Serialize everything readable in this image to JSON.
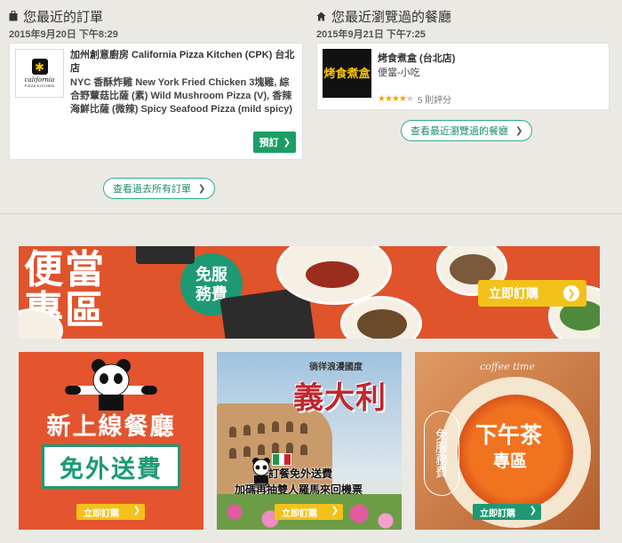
{
  "recent_orders": {
    "title": "您最近的訂單",
    "date": "2015年9月20日 下午8:29",
    "restaurant": "加州創意廚房 California Pizza Kitchen (CPK) 台北店",
    "items": "NYC 香酥炸雞 New York Fried Chicken 3塊雞, 綜合野蕈菇比薩 (素) Wild Mushroom Pizza (V), 香辣海鮮比薩 (微辣) Spicy Seafood Pizza (mild spicy)",
    "logo_text": "california",
    "logo_sub": "PIZZA KITCHEN",
    "reorder_label": "預訂",
    "view_all_label": "查看過去所有訂單"
  },
  "recent_viewed": {
    "title": "您最近瀏覽過的餐廳",
    "date": "2015年9月21日 下午7:25",
    "restaurant": "烤食煮盒 (台北店)",
    "category": "便當-小吃",
    "logo_text": "烤食煮盒",
    "rating_stars": 4,
    "rating_max": 5,
    "reviews": "5 則評分",
    "view_all_label": "查看最近瀏覽過的餐廳"
  },
  "banner": {
    "title_line1": "便當",
    "title_line2": "專區",
    "badge_line1": "免服",
    "badge_line2": "務費",
    "cta": "立即訂購"
  },
  "tiles": [
    {
      "title": "新上線餐廳",
      "box": "免外送費",
      "cta": "立即訂購"
    },
    {
      "tag": "徜徉浪漫國度",
      "title": "義大利",
      "line1": "訂餐免外送費",
      "line2": "加碼再抽雙人羅馬來回機票",
      "cta": "立即訂購"
    },
    {
      "tag": "coffee time",
      "title": "下午茶",
      "sub": "專區",
      "stamp": "免服務費",
      "cta": "立即訂購"
    }
  ],
  "colors": {
    "accent_green": "#1b9e66",
    "banner_orange": "#e0532b",
    "cta_yellow": "#f2c21b",
    "page_bg": "#ebe9e4"
  },
  "icons": {
    "orders": "shopping-bag-icon",
    "viewed": "home-icon",
    "next": "chevron-right-icon"
  }
}
